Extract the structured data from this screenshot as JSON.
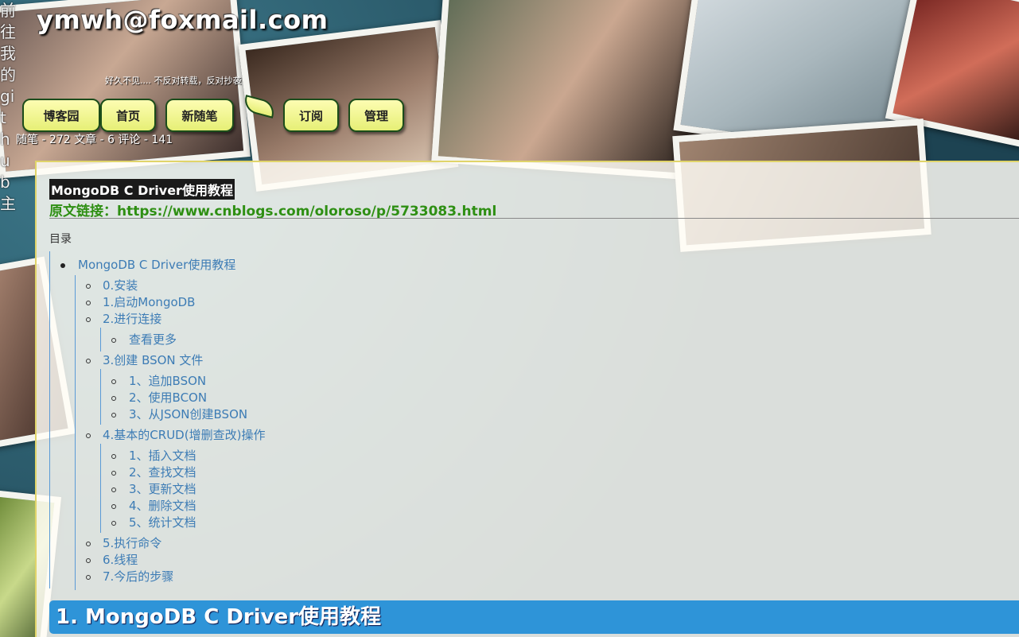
{
  "header": {
    "site_title": "ymwh@foxmail.com",
    "subtitle": "好久不见.... 不反对转载，反对抄袭",
    "vertical_text": "前往我的github主",
    "nav": [
      "博客园",
      "首页",
      "新随笔",
      "订阅",
      "管理"
    ],
    "stats": "随笔 - 272  文章 - 6  评论 - 141"
  },
  "post": {
    "title": "MongoDB C Driver使用教程",
    "orig_prefix": "原文链接：",
    "orig_url": "https://www.cnblogs.com/oloroso/p/5733083.html",
    "toc_label": "目录",
    "toc_top": "MongoDB C Driver使用教程",
    "toc": {
      "s0": "0.安装",
      "s1": "1.启动MongoDB",
      "s2": "2.进行连接",
      "s2a": "查看更多",
      "s3": "3.创建 BSON 文件",
      "s3a": "1、追加BSON",
      "s3b": "2、使用BCON",
      "s3c": "3、从JSON创建BSON",
      "s4": "4.基本的CRUD(增删查改)操作",
      "s4a": "1、插入文档",
      "s4b": "2、查找文档",
      "s4c": "3、更新文档",
      "s4d": "4、删除文档",
      "s4e": "5、统计文档",
      "s5": "5.执行命令",
      "s6": "6.线程",
      "s7": "7.今后的步骤"
    },
    "heading1": "1. MongoDB C Driver使用教程"
  },
  "colors": {
    "nav_button": "#fdfdb2",
    "link": "#3d7cb5",
    "orig_link": "#2e8f13",
    "heading_bar": "#2e94d8"
  }
}
